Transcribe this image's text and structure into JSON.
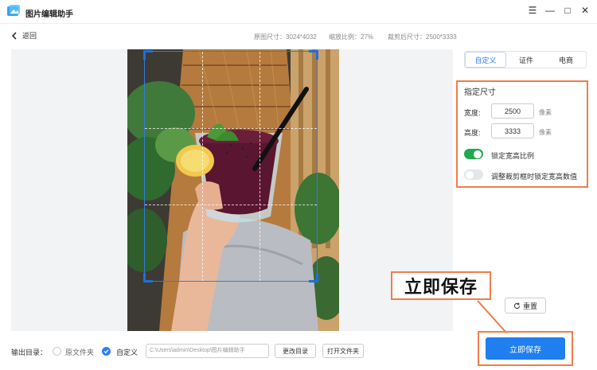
{
  "app": {
    "title": "图片编辑助手"
  },
  "window_controls": {
    "menu": "☰",
    "minimize": "—",
    "maximize": "□",
    "close": "✕"
  },
  "subbar": {
    "back_label": "返回",
    "original_size": "原图尺寸：3024*4032",
    "scale": "缩放比例：27%",
    "cropped_size": "裁剪后尺寸：2500*3333"
  },
  "tabs": [
    {
      "label": "自定义",
      "active": true
    },
    {
      "label": "证件",
      "active": false
    },
    {
      "label": "电商",
      "active": false
    }
  ],
  "size_panel": {
    "title": "指定尺寸",
    "width_label": "宽度:",
    "width_value": "2500",
    "height_label": "高度:",
    "height_value": "3333",
    "unit": "像素",
    "lock_ratio_label": "锁定宽高比例",
    "lock_ratio_on": true,
    "adjust_lock_label": "调整裁剪框时锁定宽高数值",
    "adjust_lock_on": false
  },
  "reset_label": "重置",
  "callout_text": "立即保存",
  "footer": {
    "output_label": "输出目录：",
    "option_source": "原文件夹",
    "option_custom": "自定义",
    "selected": "自定义",
    "path_value": "C:\\Users\\admin\\Desktop\\图片编辑助手",
    "change_dir_label": "更改目录",
    "open_folder_label": "打开文件夹",
    "save_label": "立即保存"
  },
  "colors": {
    "accent": "#2a7cff",
    "toggle_on": "#1ea94d",
    "highlight": "#f07d4a",
    "save": "#1f7ef0"
  }
}
